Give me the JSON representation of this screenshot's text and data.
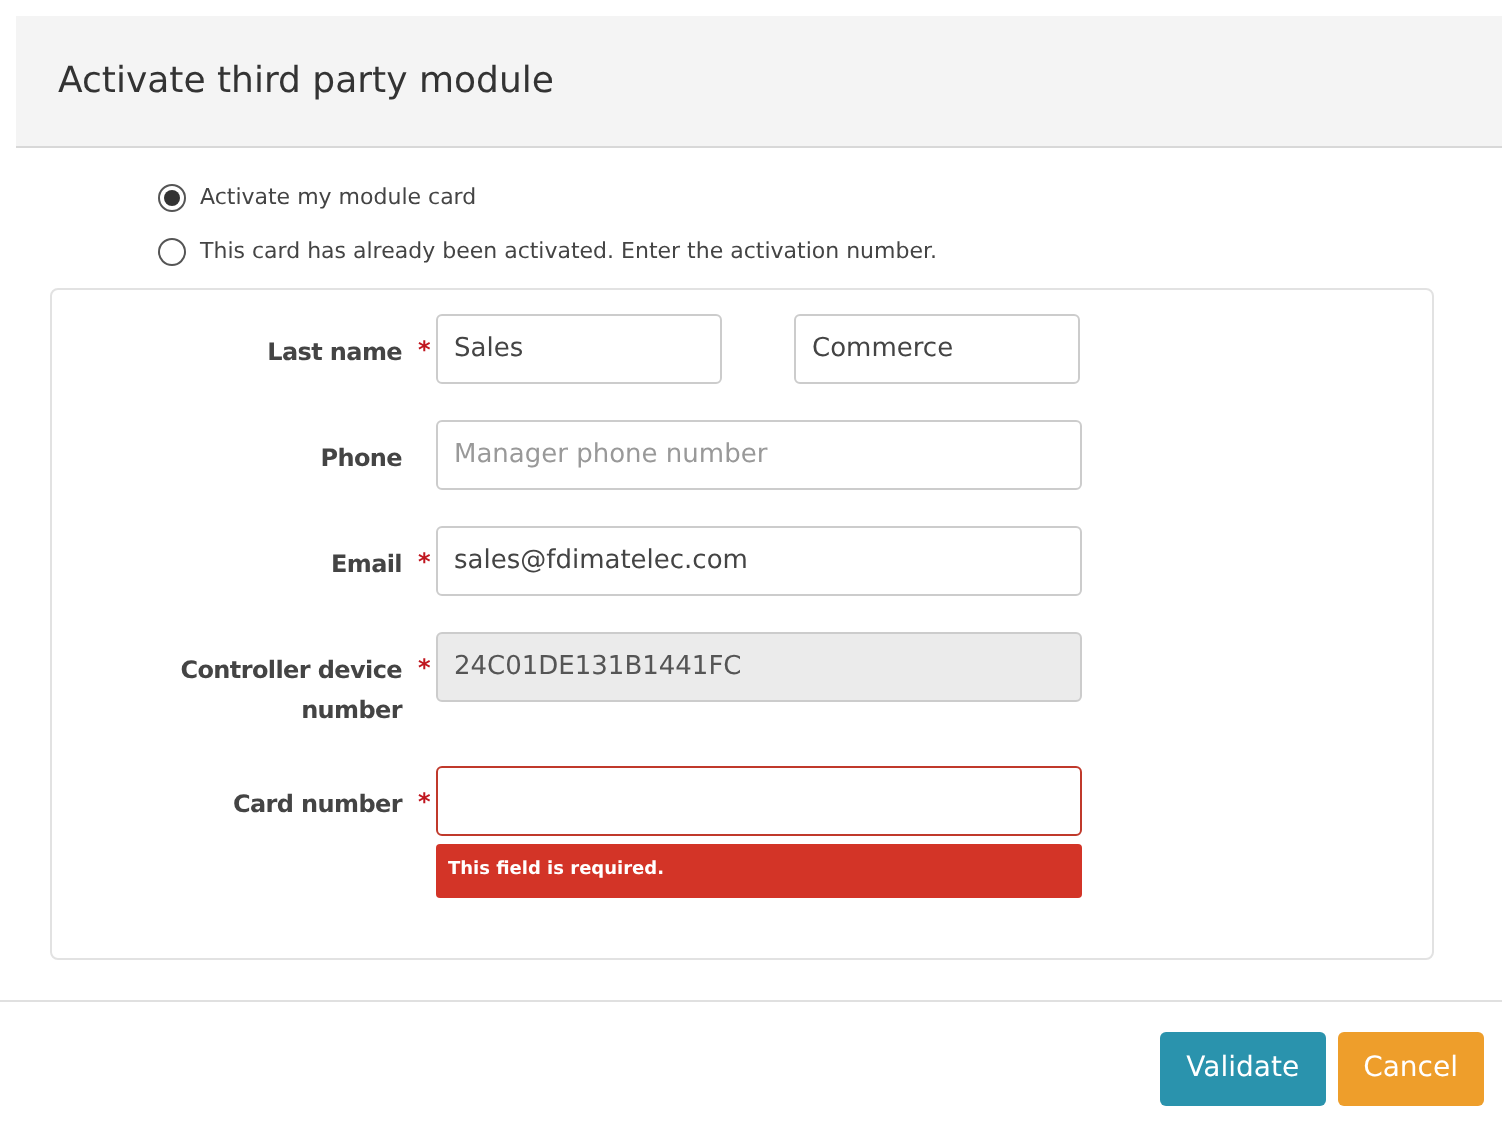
{
  "dialog": {
    "title": "Activate third party module"
  },
  "options": [
    {
      "label": "Activate my module card",
      "selected": true
    },
    {
      "label": "This card has already been activated. Enter the activation number.",
      "selected": false
    }
  ],
  "fields": [
    {
      "label": "Last name",
      "required_mark": "*",
      "inputs": [
        {
          "value": "Sales"
        },
        {
          "value": "Commerce"
        }
      ]
    },
    {
      "label": "Phone",
      "inputs": [
        {
          "placeholder": "Manager phone number"
        }
      ]
    },
    {
      "label": "Email",
      "required_mark": "*",
      "inputs": [
        {
          "value": "sales@fdimatelec.com"
        }
      ]
    },
    {
      "label": "Controller device number",
      "required_mark": "*",
      "inputs": [
        {
          "value": "24C01DE131B1441FC",
          "disabled": true
        }
      ]
    },
    {
      "label": "Card number",
      "required_mark": "*",
      "inputs": [
        {
          "focused": true
        }
      ],
      "error": "This field is required."
    }
  ],
  "buttons": [
    {
      "label": "Validate",
      "kind": "primary"
    },
    {
      "label": "Cancel",
      "kind": "secondary"
    }
  ]
}
